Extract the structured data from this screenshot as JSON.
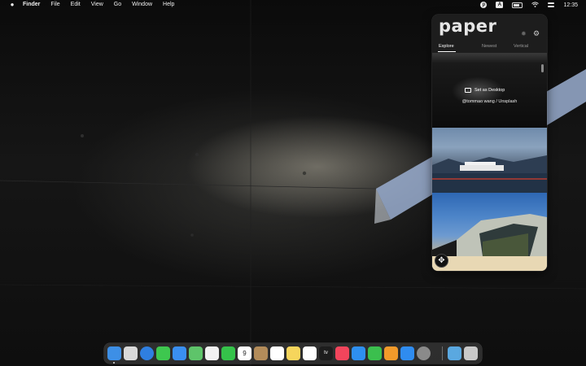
{
  "menubar": {
    "app_name": "Finder",
    "items": [
      "File",
      "Edit",
      "View",
      "Go",
      "Window",
      "Help"
    ],
    "clock": "12:35",
    "input_source": "A",
    "status_icons": [
      "paper-menu-icon",
      "input-source-icon",
      "battery-icon",
      "wifi-icon",
      "control-center-icon"
    ]
  },
  "panel": {
    "logo_text": "paper",
    "tabs": [
      {
        "label": "Explore",
        "active": true
      },
      {
        "label": "Newest",
        "active": false
      },
      {
        "label": "Vertical",
        "active": false
      }
    ],
    "set_desktop_label": "Set as Desktop",
    "credit": "@tommao wang / Unsplash"
  },
  "dock": {
    "apps": [
      {
        "name": "finder-icon",
        "color": "#3d8fe6"
      },
      {
        "name": "launchpad-icon",
        "color": "#d9d9d9"
      },
      {
        "name": "safari-icon",
        "color": "#2f7fe0"
      },
      {
        "name": "messages-icon",
        "color": "#3ec74f"
      },
      {
        "name": "mail-icon",
        "color": "#3a8ff0"
      },
      {
        "name": "maps-icon",
        "color": "#5ec46a"
      },
      {
        "name": "photos-icon",
        "color": "#f2f2f2"
      },
      {
        "name": "facetime-icon",
        "color": "#35c24a"
      },
      {
        "name": "calendar-icon",
        "color": "#ffffff"
      },
      {
        "name": "contacts-icon",
        "color": "#b38c5a"
      },
      {
        "name": "reminders-icon",
        "color": "#ffffff"
      },
      {
        "name": "notes-icon",
        "color": "#f6d55c"
      },
      {
        "name": "freeform-icon",
        "color": "#ffffff"
      },
      {
        "name": "tv-icon",
        "color": "#1d1d1d"
      },
      {
        "name": "music-icon",
        "color": "#f2455c"
      },
      {
        "name": "keynote-icon",
        "color": "#2e8ff0"
      },
      {
        "name": "numbers-icon",
        "color": "#3bbf4e"
      },
      {
        "name": "pages-icon",
        "color": "#f39a2a"
      },
      {
        "name": "app-store-icon",
        "color": "#2f8cf0"
      },
      {
        "name": "system-settings-icon",
        "color": "#8a8a8a"
      },
      {
        "name": "downloads-folder-icon",
        "color": "#5aa8e0"
      },
      {
        "name": "trash-icon",
        "color": "#c9c9c9"
      }
    ],
    "calendar_day": "9",
    "tv_label": "tv"
  }
}
